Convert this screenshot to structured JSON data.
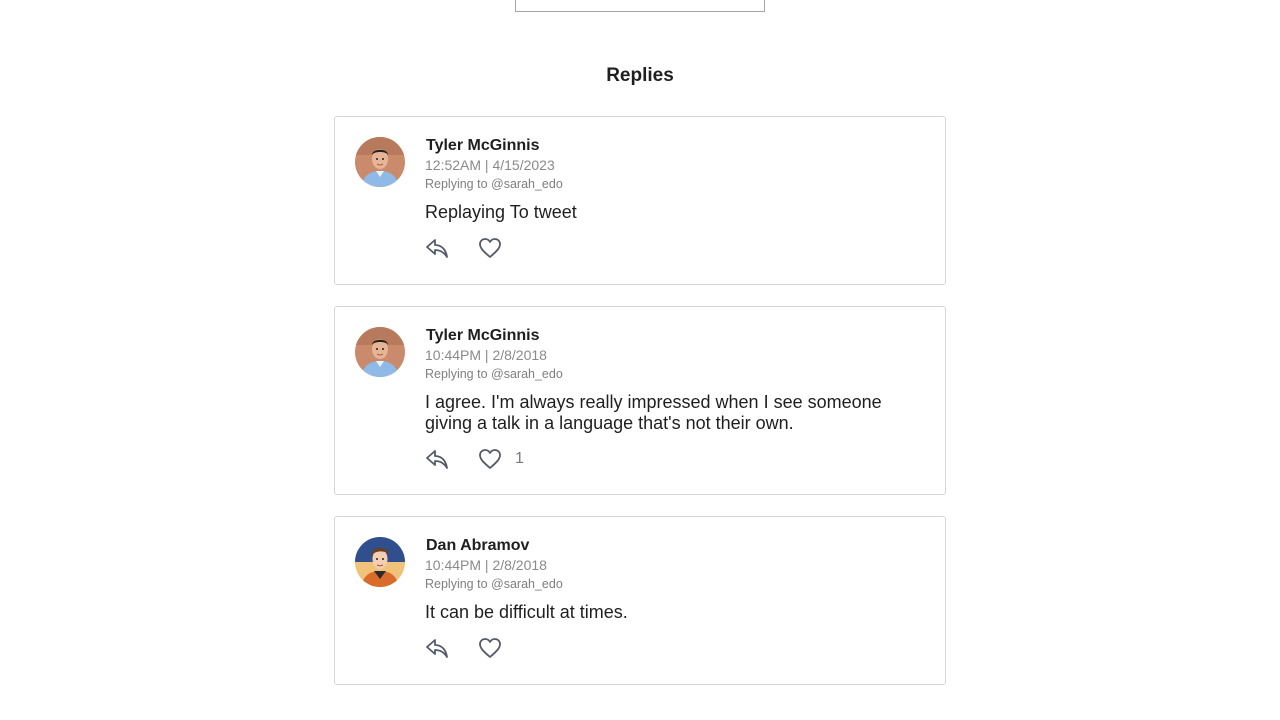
{
  "heading": "Replies",
  "tweets": [
    {
      "author": "Tyler McGinnis",
      "timestamp": "12:52AM | 4/15/2023",
      "replying_to": "Replying to @sarah_edo",
      "text": "Replaying To tweet",
      "likes": "",
      "avatar": "tyler"
    },
    {
      "author": "Tyler McGinnis",
      "timestamp": "10:44PM | 2/8/2018",
      "replying_to": "Replying to @sarah_edo",
      "text": "I agree. I'm always really impressed when I see someone giving a talk in a language that's not their own.",
      "likes": "1",
      "avatar": "tyler"
    },
    {
      "author": "Dan Abramov",
      "timestamp": "10:44PM | 2/8/2018",
      "replying_to": "Replying to @sarah_edo",
      "text": "It can be difficult at times.",
      "likes": "",
      "avatar": "dan"
    }
  ],
  "icons": {
    "reply": "reply-arrow-icon",
    "like": "heart-outline-icon"
  },
  "colors": {
    "icon": "#555b66",
    "border": "#d6d6d6",
    "muted_text": "#8a8a8a"
  }
}
